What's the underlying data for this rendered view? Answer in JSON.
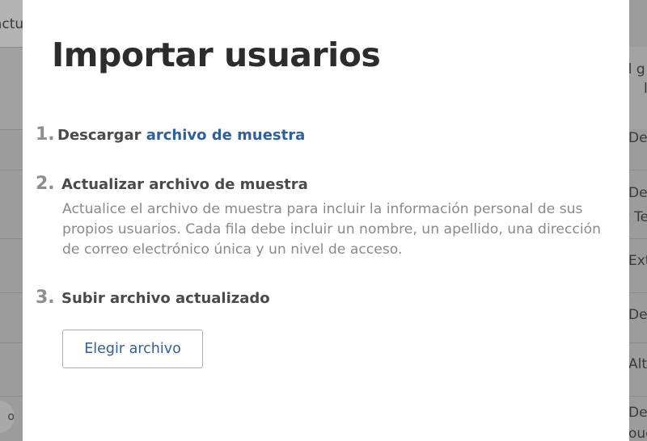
{
  "background": {
    "left_partial_text": "actu",
    "right_header_partial": "ll g",
    "right_header_partial_2": "l",
    "right_rows": [
      "De",
      "De",
      "t Te",
      "Ext",
      "De",
      "Alt",
      "De",
      "ouc"
    ],
    "circle_partial": "o"
  },
  "modal": {
    "title": "Importar usuarios",
    "steps": [
      {
        "number": "1.",
        "title_prefix": "Descargar ",
        "link": "archivo de muestra"
      },
      {
        "number": "2.",
        "title": "Actualizar archivo de muestra",
        "description": "Actualice el archivo de muestra para incluir la información personal de sus propios usuarios. Cada fila debe incluir un nombre, un apellido, una dirección de correo electrónico única y un nivel de acceso."
      },
      {
        "number": "3.",
        "title": "Subir archivo actualizado"
      }
    ],
    "choose_button": "Elegir archivo"
  },
  "colors": {
    "link": "#2f5f9e",
    "overlay": "#9c9c9c",
    "title": "#2c2c2c",
    "description": "#8a8a8a"
  }
}
